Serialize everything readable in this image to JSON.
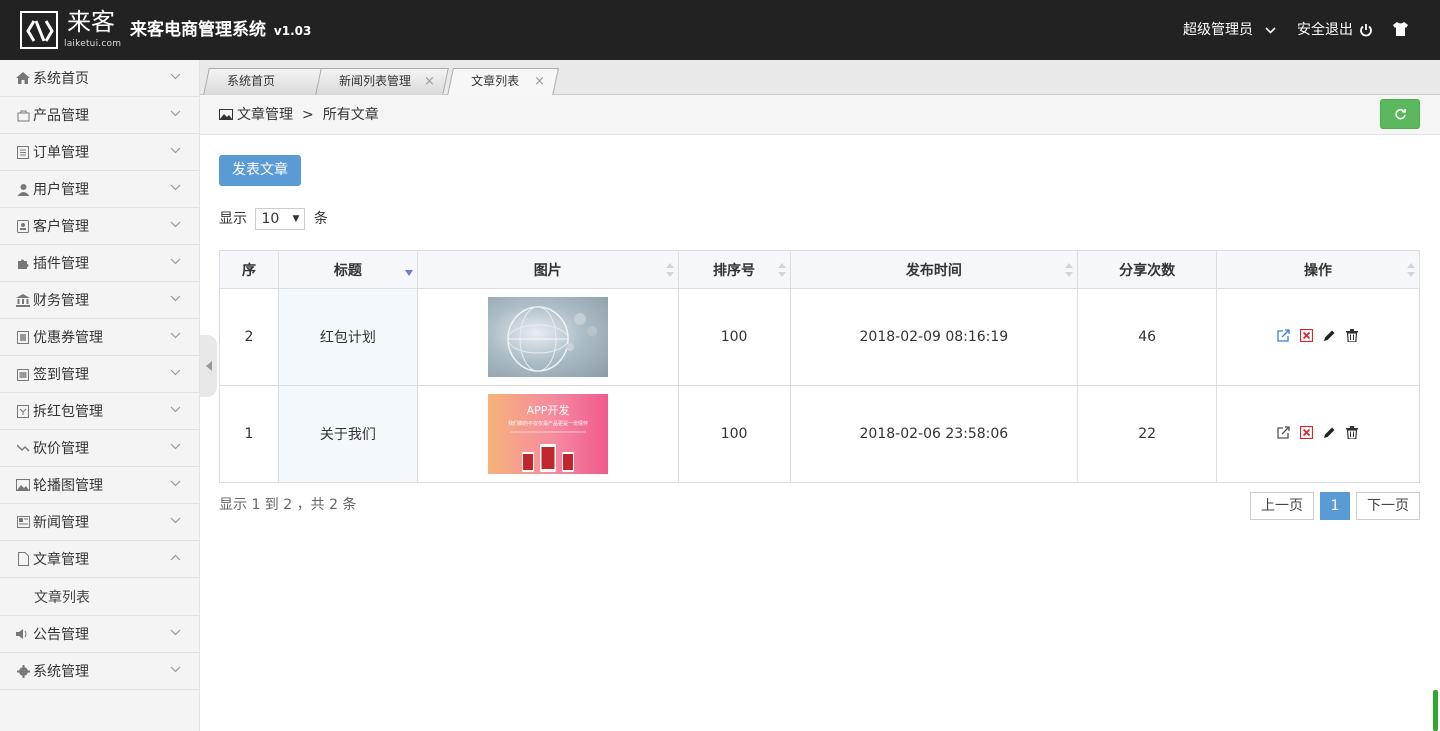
{
  "header": {
    "logo_cn": "来客",
    "logo_en": "laiketui.com",
    "title": "来客电商管理系统",
    "version": "v1.03",
    "user": "超级管理员",
    "logout": "安全退出"
  },
  "sidebar": {
    "items": [
      {
        "label": "系统首页",
        "icon": "home-icon"
      },
      {
        "label": "产品管理",
        "icon": "bag-icon"
      },
      {
        "label": "订单管理",
        "icon": "list-icon"
      },
      {
        "label": "用户管理",
        "icon": "user-icon"
      },
      {
        "label": "客户管理",
        "icon": "contact-icon"
      },
      {
        "label": "插件管理",
        "icon": "puzzle-icon"
      },
      {
        "label": "财务管理",
        "icon": "bank-icon"
      },
      {
        "label": "优惠券管理",
        "icon": "coupon-icon"
      },
      {
        "label": "签到管理",
        "icon": "checkin-icon"
      },
      {
        "label": "拆红包管理",
        "icon": "redpacket-icon"
      },
      {
        "label": "砍价管理",
        "icon": "bargain-icon"
      },
      {
        "label": "轮播图管理",
        "icon": "image-icon"
      },
      {
        "label": "新闻管理",
        "icon": "news-icon"
      },
      {
        "label": "文章管理",
        "icon": "file-icon",
        "expanded": true
      },
      {
        "label": "公告管理",
        "icon": "speaker-icon"
      },
      {
        "label": "系统管理",
        "icon": "gear-icon"
      }
    ],
    "subitem": "文章列表"
  },
  "tabs": [
    {
      "label": "系统首页"
    },
    {
      "label": "新闻列表管理"
    },
    {
      "label": "文章列表"
    }
  ],
  "breadcrumb": {
    "parent": "文章管理",
    "sep": ">",
    "current": "所有文章"
  },
  "actions": {
    "publish": "发表文章"
  },
  "length": {
    "prefix": "显示",
    "value": "10",
    "suffix": "条"
  },
  "table": {
    "columns": [
      "序",
      "标题",
      "图片",
      "排序号",
      "发布时间",
      "分享次数",
      "操作"
    ],
    "rows": [
      {
        "id": "2",
        "title": "红包计划",
        "sort": "100",
        "time": "2018-02-09 08:16:19",
        "shares": "46"
      },
      {
        "id": "1",
        "title": "关于我们",
        "sort": "100",
        "time": "2018-02-06 23:58:06",
        "shares": "22"
      }
    ],
    "thumb2_title": "APP开发",
    "thumb2_sub": "我们做的不仅仅是产品更是一份情怀"
  },
  "footer": {
    "info": "显示 1 到 2 ，共 2 条",
    "prev": "上一页",
    "current_page": "1",
    "next": "下一页"
  }
}
